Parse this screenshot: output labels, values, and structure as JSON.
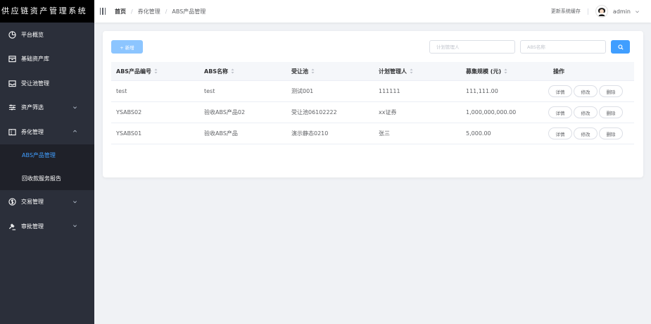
{
  "app": {
    "title": "供应链资产管理系统"
  },
  "sidebar": {
    "items": [
      {
        "label": "平台概览",
        "icon": "dashboard-icon"
      },
      {
        "label": "基础资产库",
        "icon": "archive-icon"
      },
      {
        "label": "受让池管理",
        "icon": "inbox-icon"
      },
      {
        "label": "资产筛选",
        "icon": "sliders-icon",
        "expandable": true
      },
      {
        "label": "券化管理",
        "icon": "ticket-icon",
        "expanded": true,
        "children": [
          {
            "label": "ABS产品管理",
            "active": true
          },
          {
            "label": "回收款服务报告"
          }
        ]
      },
      {
        "label": "交易管理",
        "icon": "coin-icon",
        "expandable": true
      },
      {
        "label": "审批管理",
        "icon": "gavel-icon",
        "expandable": true
      }
    ]
  },
  "header": {
    "breadcrumb": {
      "home": "首页",
      "level1": "券化管理",
      "level2": "ABS产品管理"
    },
    "refresh_label": "更新系统缓存",
    "user": "admin"
  },
  "toolbar": {
    "add_label": "+ 新增",
    "manager_placeholder": "计划管理人",
    "name_placeholder": "ABS名称"
  },
  "table": {
    "headers": [
      "ABS产品编号",
      "ABS名称",
      "受让池",
      "计划管理人",
      "募集规模 (元)",
      "操作"
    ],
    "rows": [
      [
        "test",
        "test",
        "测试001",
        "111111",
        "111,111.00"
      ],
      [
        "YSABS02",
        "验收ABS产品02",
        "受让池06102222",
        "xx证券",
        "1,000,000,000.00"
      ],
      [
        "YSABS01",
        "验收ABS产品",
        "演示静态0210",
        "张三",
        "5,000.00"
      ]
    ],
    "actions": {
      "detail": "详情",
      "edit": "修改",
      "delete": "删除"
    }
  },
  "colors": {
    "accent": "#409eff",
    "sidebar_bg": "#2b2f3a",
    "brand_bg": "#000000"
  }
}
